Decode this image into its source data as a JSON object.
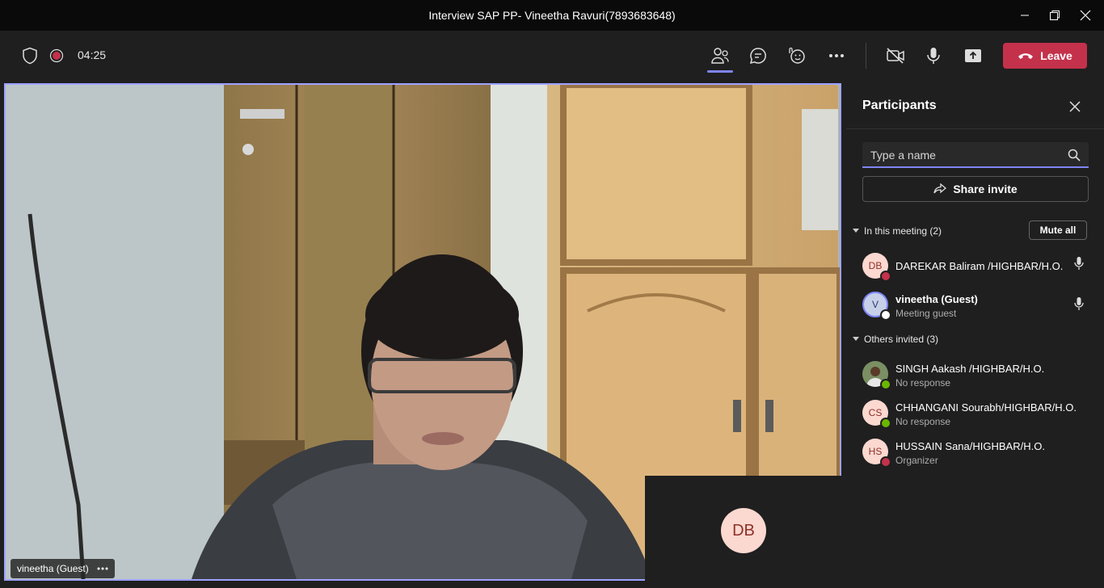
{
  "window": {
    "title": "Interview SAP PP- Vineetha Ravuri(7893683648)"
  },
  "toolbar": {
    "timer": "04:25",
    "leave_label": "Leave"
  },
  "stage": {
    "main_name_tag": "vineetha (Guest)",
    "self_initials": "DB"
  },
  "panel": {
    "title": "Participants",
    "search_placeholder": "Type a name",
    "share_label": "Share invite",
    "in_meeting_label": "In this meeting (2)",
    "mute_all_label": "Mute all",
    "others_label": "Others invited (3)",
    "in_meeting": [
      {
        "initials": "DB",
        "name": "DAREKAR Baliram /HIGHBAR/H.O.",
        "subtitle": "",
        "status": "busy",
        "status_color": "#c4314b"
      },
      {
        "initials": "V",
        "name": "vineetha (Guest)",
        "subtitle": "Meeting guest",
        "status": "offline",
        "status_color": "#ffffff"
      }
    ],
    "others": [
      {
        "initials": "",
        "name": "SINGH Aakash /HIGHBAR/H.O.",
        "subtitle": "No response",
        "status": "available",
        "status_color": "#6bb700"
      },
      {
        "initials": "CS",
        "name": "CHHANGANI Sourabh/HIGHBAR/H.O.",
        "subtitle": "No response",
        "status": "available",
        "status_color": "#6bb700"
      },
      {
        "initials": "HS",
        "name": "HUSSAIN Sana/HIGHBAR/H.O.",
        "subtitle": "Organizer",
        "status": "busy",
        "status_color": "#c4314b"
      }
    ]
  },
  "colors": {
    "accent": "#7f85f5",
    "leave": "#c4314b",
    "avatar_bg": "#fbd8d0",
    "avatar_fg": "#8d3128"
  },
  "icons": [
    "shield-icon",
    "record-icon",
    "participants-icon",
    "chat-icon",
    "reactions-icon",
    "more-icon",
    "camera-off-icon",
    "mic-icon",
    "share-screen-icon",
    "phone-hangup-icon",
    "close-icon",
    "search-icon",
    "share-icon",
    "chevron-down-icon",
    "minimize-icon",
    "restore-icon"
  ]
}
